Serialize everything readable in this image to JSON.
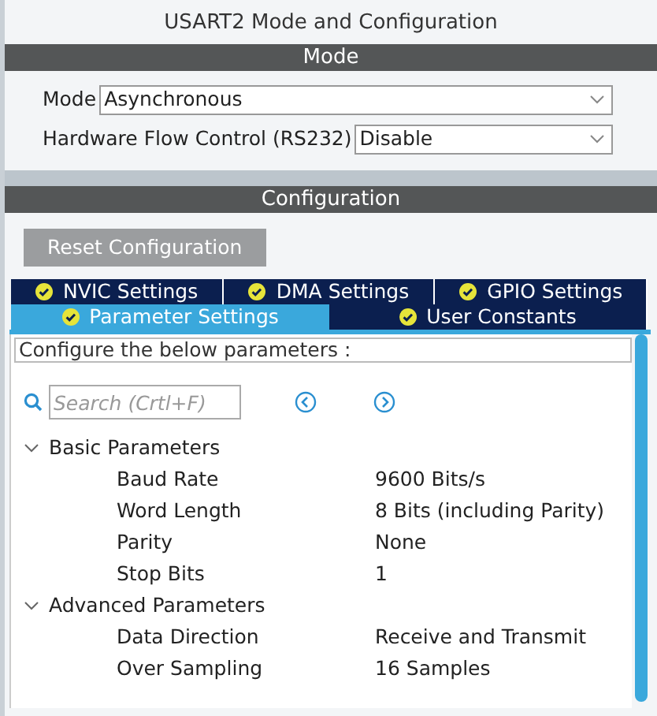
{
  "window": {
    "title": "USART2 Mode and Configuration"
  },
  "mode": {
    "header": "Mode",
    "fields": [
      {
        "label": "Mode",
        "value": "Asynchronous"
      },
      {
        "label": "Hardware Flow Control (RS232)",
        "value": "Disable"
      }
    ]
  },
  "configuration": {
    "header": "Configuration",
    "reset_button": "Reset Configuration",
    "tab_rows": [
      [
        {
          "label": "NVIC Settings",
          "selected": false
        },
        {
          "label": "DMA Settings",
          "selected": false
        },
        {
          "label": "GPIO Settings",
          "selected": false
        }
      ],
      [
        {
          "label": "Parameter Settings",
          "selected": true
        },
        {
          "label": "User Constants",
          "selected": false
        }
      ]
    ],
    "description": "Configure the below parameters :",
    "search": {
      "placeholder": "Search (Crtl+F)"
    },
    "groups": [
      {
        "label": "Basic Parameters",
        "expanded": true,
        "children": [
          {
            "name": "Baud Rate",
            "value": "9600 Bits/s"
          },
          {
            "name": "Word Length",
            "value": "8 Bits (including Parity)"
          },
          {
            "name": "Parity",
            "value": "None"
          },
          {
            "name": "Stop Bits",
            "value": "1"
          }
        ]
      },
      {
        "label": "Advanced Parameters",
        "expanded": true,
        "children": [
          {
            "name": "Data Direction",
            "value": "Receive and Transmit"
          },
          {
            "name": "Over Sampling",
            "value": "16 Samples"
          }
        ]
      }
    ]
  }
}
